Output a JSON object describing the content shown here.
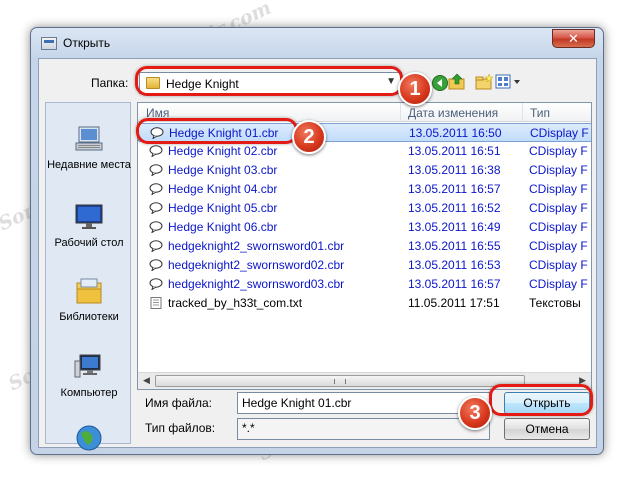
{
  "window": {
    "title": "Открыть",
    "close_glyph": "✕"
  },
  "toolbar": {
    "folder_label": "Папка:",
    "folder_value": "Hedge Knight",
    "icons": [
      "back-icon",
      "up-folder-icon",
      "new-folder-icon",
      "view-menu-icon"
    ]
  },
  "places": [
    {
      "label": "Недавние места",
      "icon": "recent-places-icon"
    },
    {
      "label": "Рабочий стол",
      "icon": "desktop-icon"
    },
    {
      "label": "Библиотеки",
      "icon": "libraries-icon"
    },
    {
      "label": "Компьютер",
      "icon": "computer-icon"
    },
    {
      "label": "",
      "icon": "network-icon"
    }
  ],
  "list": {
    "columns": [
      "Имя",
      "Дата изменения",
      "Тип"
    ],
    "rows": [
      {
        "name": "Hedge Knight 01.cbr",
        "date": "13.05.2011 16:50",
        "type": "CDisplay F",
        "selected": true
      },
      {
        "name": "Hedge Knight 02.cbr",
        "date": "13.05.2011 16:51",
        "type": "CDisplay F"
      },
      {
        "name": "Hedge Knight 03.cbr",
        "date": "13.05.2011 16:38",
        "type": "CDisplay F"
      },
      {
        "name": "Hedge Knight 04.cbr",
        "date": "13.05.2011 16:57",
        "type": "CDisplay F"
      },
      {
        "name": "Hedge Knight 05.cbr",
        "date": "13.05.2011 16:52",
        "type": "CDisplay F"
      },
      {
        "name": "Hedge Knight 06.cbr",
        "date": "13.05.2011 16:49",
        "type": "CDisplay F"
      },
      {
        "name": "hedgeknight2_swornsword01.cbr",
        "date": "13.05.2011 16:55",
        "type": "CDisplay F"
      },
      {
        "name": "hedgeknight2_swornsword02.cbr",
        "date": "13.05.2011 16:53",
        "type": "CDisplay F"
      },
      {
        "name": "hedgeknight2_swornsword03.cbr",
        "date": "13.05.2011 16:57",
        "type": "CDisplay F"
      },
      {
        "name": "tracked_by_h33t_com.txt",
        "date": "11.05.2011 17:51",
        "type": "Текстовы",
        "plain": true
      }
    ]
  },
  "filename": {
    "label": "Имя файла:",
    "value": "Hedge Knight 01.cbr"
  },
  "filetype": {
    "label": "Тип файлов:",
    "value": "*.*"
  },
  "buttons": {
    "open": "Открыть",
    "cancel": "Отмена"
  },
  "callouts": [
    "1",
    "2",
    "3"
  ],
  "watermark": "Soringpcrepair.com",
  "colors": {
    "highlight": "#e31b14",
    "link_text": "#0b16c9",
    "selection": "#c1dcfb"
  }
}
